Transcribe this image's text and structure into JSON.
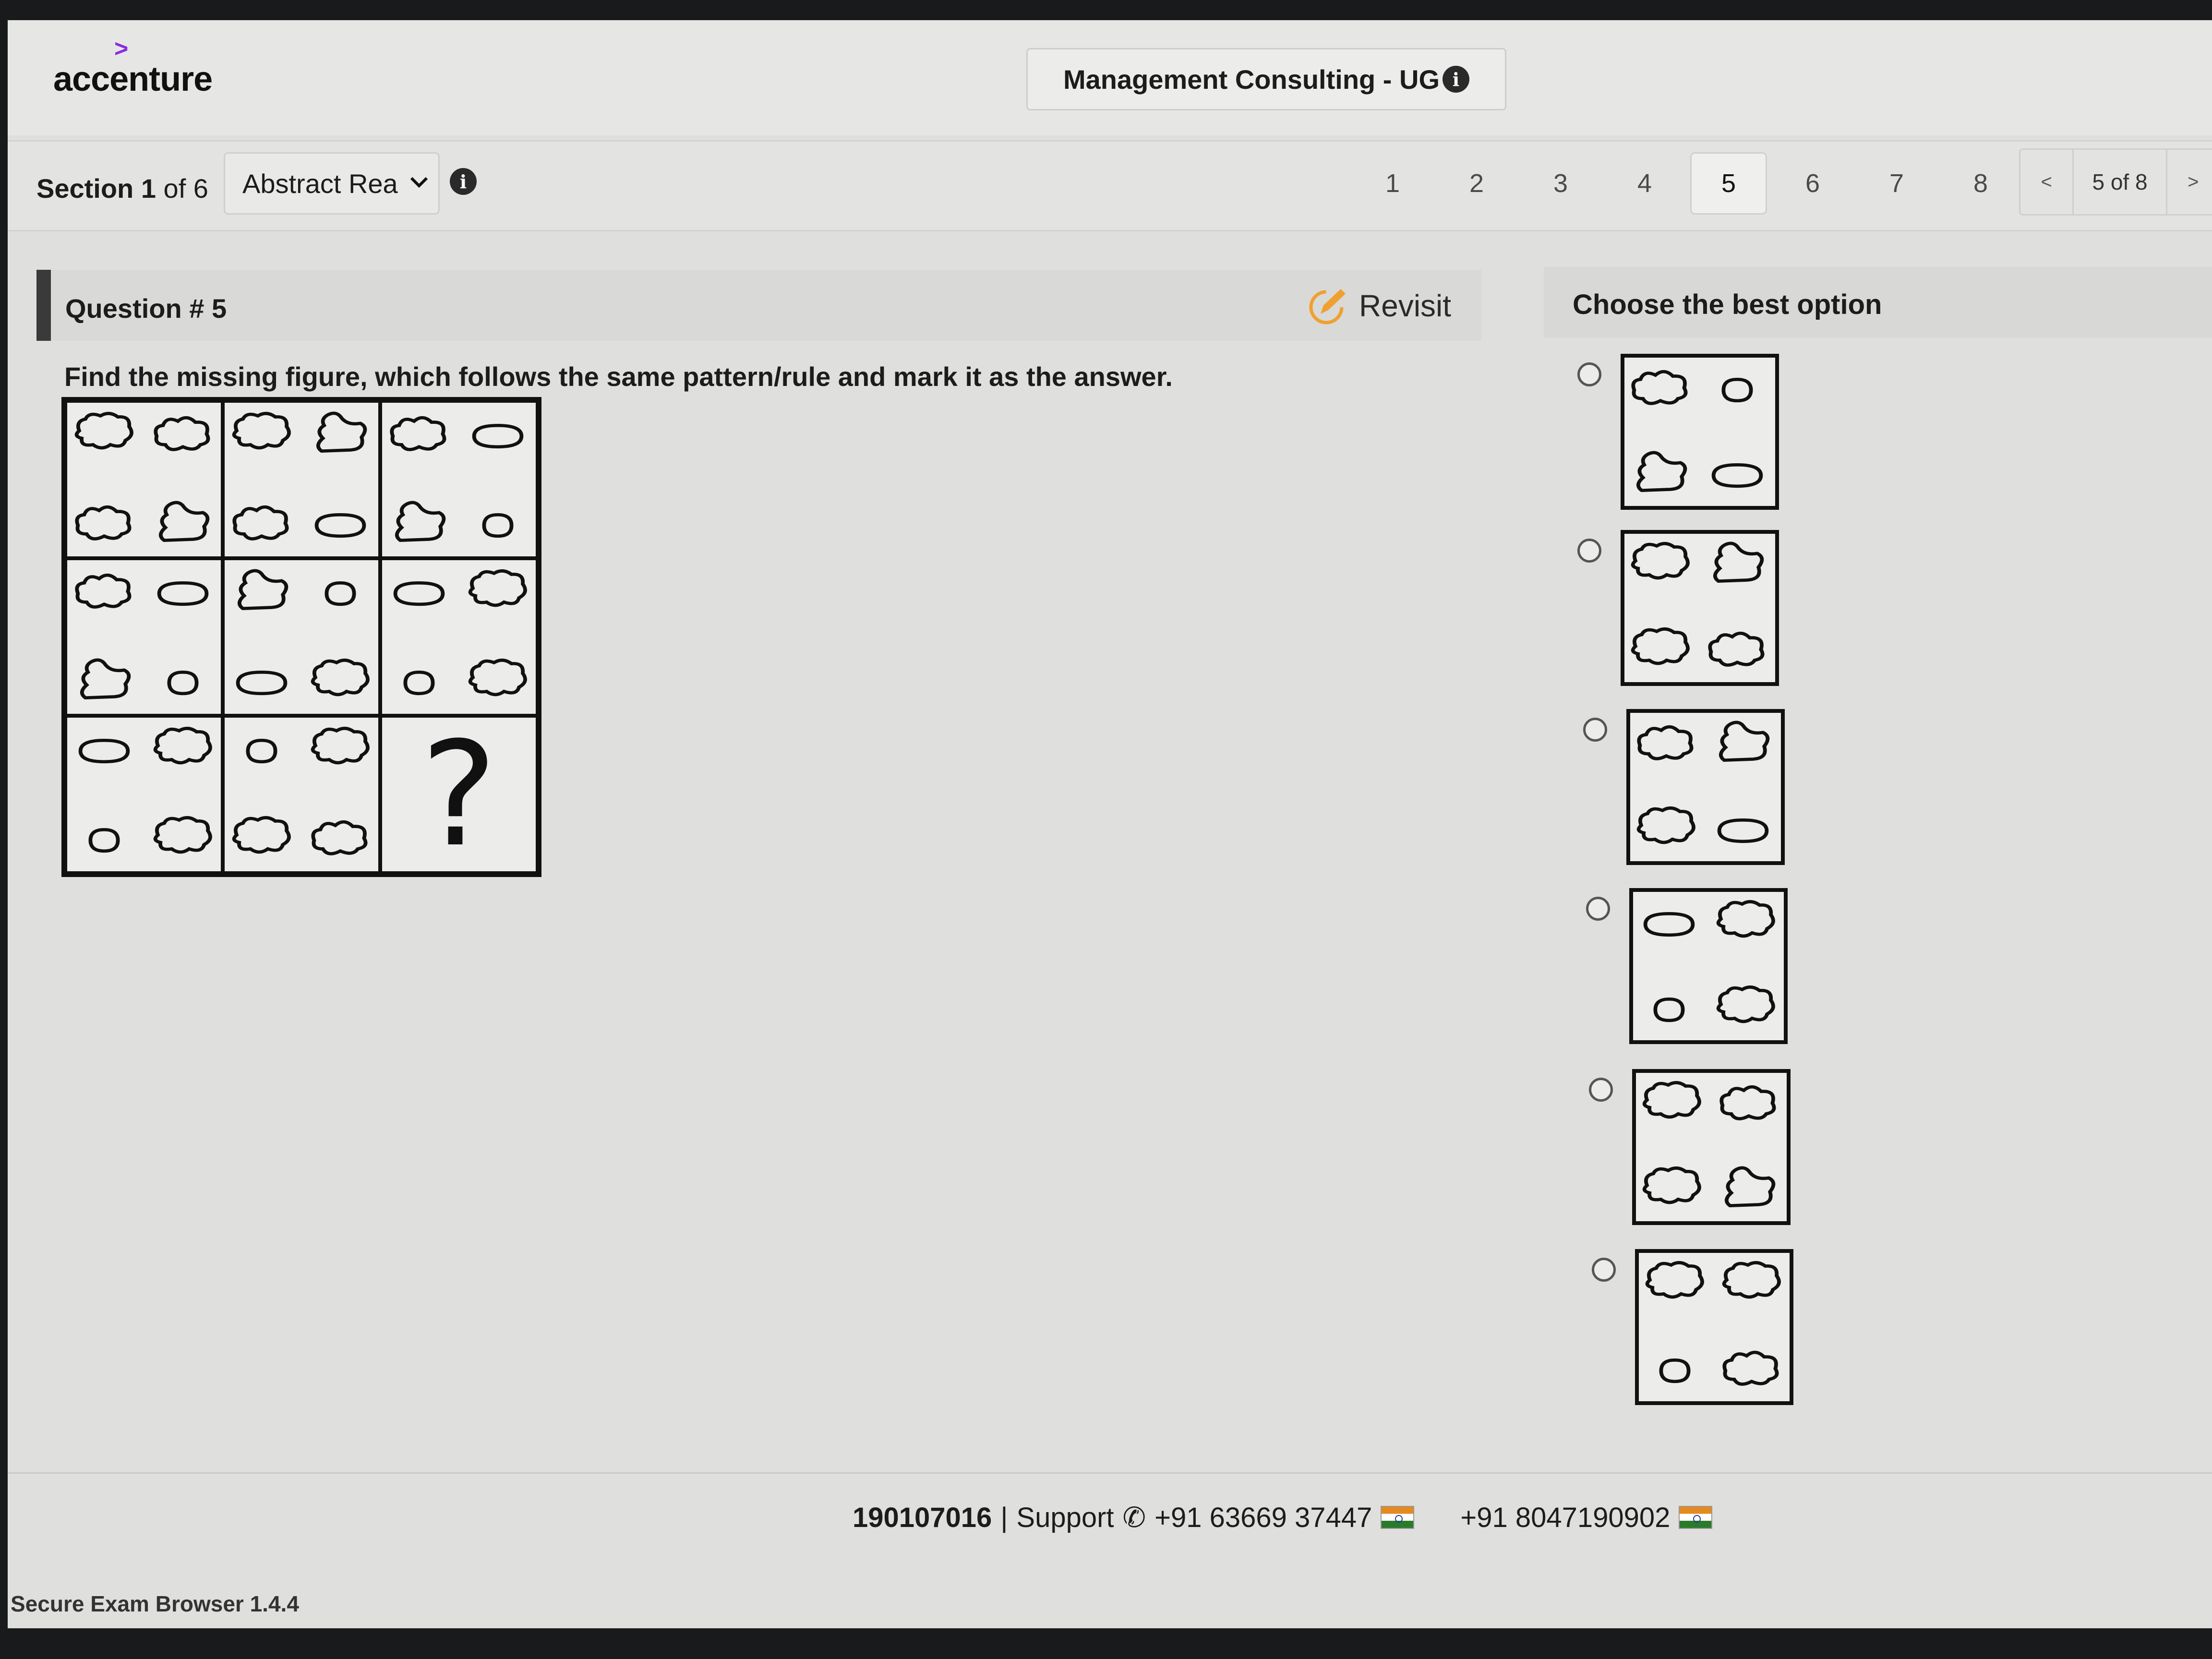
{
  "header": {
    "logo_text": "accenture",
    "logo_mark": ">",
    "exam_title": "Management Consulting - UG"
  },
  "nav": {
    "section_prefix": "Section",
    "section_number": "1",
    "section_suffix": "of 6",
    "section_select_value": "Abstract Rea",
    "question_numbers": [
      "1",
      "2",
      "3",
      "4",
      "5",
      "6",
      "7",
      "8"
    ],
    "active_question": "5",
    "pager_prev": "<",
    "pager_count": "5 of 8",
    "pager_next": ">"
  },
  "question": {
    "title": "Question # 5",
    "revisit_label": "Revisit",
    "instruction": "Find the missing figure, which follows the same pattern/rule and mark it as the answer.",
    "missing_mark": "?"
  },
  "options": {
    "title": "Choose the best option"
  },
  "footer": {
    "candidate_id": "190107016",
    "separator": "|",
    "support_label": "Support",
    "phone_1": "+91 63669 37447",
    "phone_2": "+91 8047190902",
    "browser_version": "Secure Exam Browser 1.4.4"
  },
  "icons": {
    "info": "info-icon",
    "revisit": "edit-pencil-icon",
    "phone": "phone-icon",
    "flag": "india-flag-icon",
    "dropdown": "chevron-down-icon"
  },
  "colors": {
    "logo_accent": "#8a2be2",
    "revisit_accent": "#f0a030"
  }
}
